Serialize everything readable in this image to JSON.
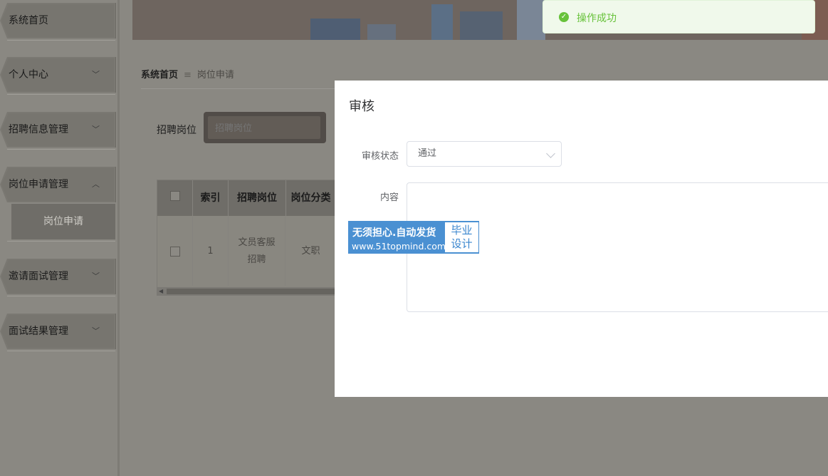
{
  "sidebar": {
    "items": [
      {
        "label": "系统首页",
        "chevron": ""
      },
      {
        "label": "个人中心",
        "chevron": "﹀"
      },
      {
        "label": "招聘信息管理",
        "chevron": "﹀"
      },
      {
        "label": "岗位申请管理",
        "chevron": "︿"
      },
      {
        "label": "邀请面试管理",
        "chevron": "﹀"
      },
      {
        "label": "面试结果管理",
        "chevron": "﹀"
      }
    ],
    "submenu": {
      "label": "岗位申请"
    }
  },
  "breadcrumb": {
    "home": "系统首页",
    "separator": "≡",
    "current": "岗位申请"
  },
  "search": {
    "label": "招聘岗位",
    "placeholder": "招聘岗位"
  },
  "table": {
    "headers": [
      "索引",
      "招聘岗位",
      "岗位分类"
    ],
    "rows": [
      {
        "index": "1",
        "position": "文员客服招聘",
        "category": "文职"
      }
    ]
  },
  "toast": {
    "message": "操作成功",
    "icon": "check-circle-icon",
    "color": "#67c23a"
  },
  "dialog": {
    "title": "审核",
    "status_label": "审核状态",
    "status_value": "通过",
    "content_label": "内容",
    "content_value": ""
  },
  "watermark": {
    "line1": "无须担心.自动发货",
    "line2": "www.51topmind.com",
    "right_line1": "毕业",
    "right_line2": "设计"
  }
}
